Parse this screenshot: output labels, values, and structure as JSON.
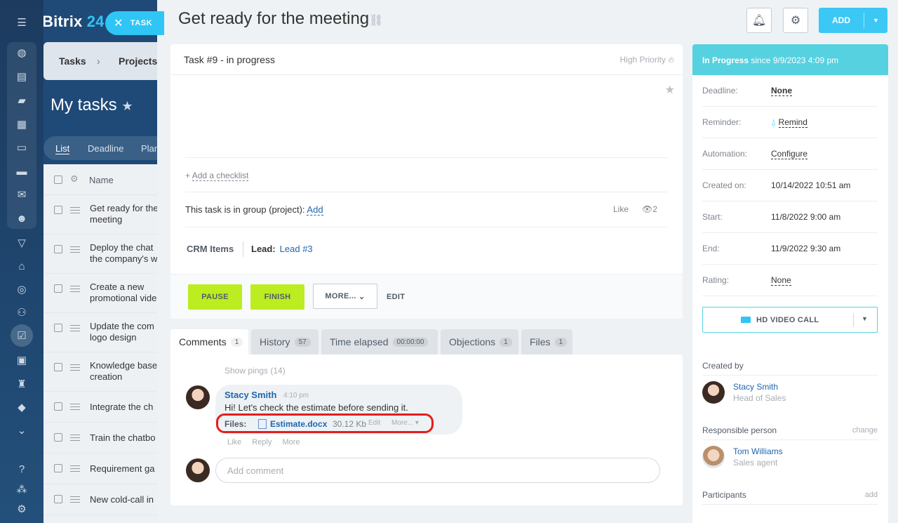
{
  "app": {
    "logo_text": "Bitrix",
    "logo_num": "24"
  },
  "background": {
    "breadcrumbs": [
      "Tasks",
      "Projects"
    ],
    "page_title": "My tasks",
    "view_tabs": [
      "List",
      "Deadline",
      "Plan"
    ],
    "grid_header": "Name",
    "rows": [
      "Get ready for the meeting",
      "Deploy the chat the company's w",
      "Create a new promotional vide",
      "Update the com logo design",
      "Knowledge base creation",
      "Integrate the ch",
      "Train the chatbo",
      "Requirement ga",
      "New cold-call in"
    ]
  },
  "task_tag": {
    "label": "TASK"
  },
  "header": {
    "title": "Get ready for the meeting",
    "add_label": "ADD"
  },
  "card": {
    "task_heading": "Task #9 - in progress",
    "priority": "High Priority",
    "add_checklist": "Add a checklist",
    "group_text": "This task is in group (project):",
    "group_add": "Add",
    "like": "Like",
    "views": "2",
    "crm_label": "CRM Items",
    "lead_label": "Lead:",
    "lead_value": "Lead #3",
    "pause_label": "PAUSE",
    "finish_label": "FINISH",
    "more_label": "MORE...",
    "edit_label": "EDIT"
  },
  "tabs": [
    {
      "label": "Comments",
      "count": "1"
    },
    {
      "label": "History",
      "count": "57"
    },
    {
      "label": "Time elapsed",
      "count": "00:00:00"
    },
    {
      "label": "Objections",
      "count": "1"
    },
    {
      "label": "Files",
      "count": "1"
    }
  ],
  "comments": {
    "show_pings": "Show pings (14)",
    "author": "Stacy Smith",
    "time": "4:10 pm",
    "text": "Hi! Let's check the estimate before sending it.",
    "files_label": "Files:",
    "file_name": "Estimate.docx",
    "file_size": "30.12 Kb",
    "file_edit": "Edit",
    "file_more": "More...",
    "actions": [
      "Like",
      "Reply",
      "More"
    ],
    "add_placeholder": "Add comment"
  },
  "sidebar": {
    "status_bold": "In Progress",
    "status_rest": " since 9/9/2023 4:09 pm",
    "fields": [
      {
        "key": "Deadline:",
        "value": "None"
      },
      {
        "key": "Reminder:",
        "value": "Remind"
      },
      {
        "key": "Automation:",
        "value": "Configure"
      },
      {
        "key": "Created on:",
        "value": "10/14/2022 10:51 am"
      },
      {
        "key": "Start:",
        "value": "11/8/2022 9:00 am"
      },
      {
        "key": "End:",
        "value": "11/9/2022 9:30 am"
      },
      {
        "key": "Rating:",
        "value": "None"
      }
    ],
    "video_call": "HD VIDEO CALL",
    "created_by_label": "Created by",
    "creator": {
      "name": "Stacy Smith",
      "position": "Head of Sales"
    },
    "responsible_label": "Responsible person",
    "responsible_change": "change",
    "responsible": {
      "name": "Tom Williams",
      "position": "Sales agent"
    },
    "participants_label": "Participants",
    "participants_add": "add"
  },
  "colors": {
    "accent": "#3bc8f5",
    "green_button": "#bbed21",
    "status_bar": "#56d1e0",
    "highlight": "#e41e1e",
    "link": "#2067b0"
  }
}
